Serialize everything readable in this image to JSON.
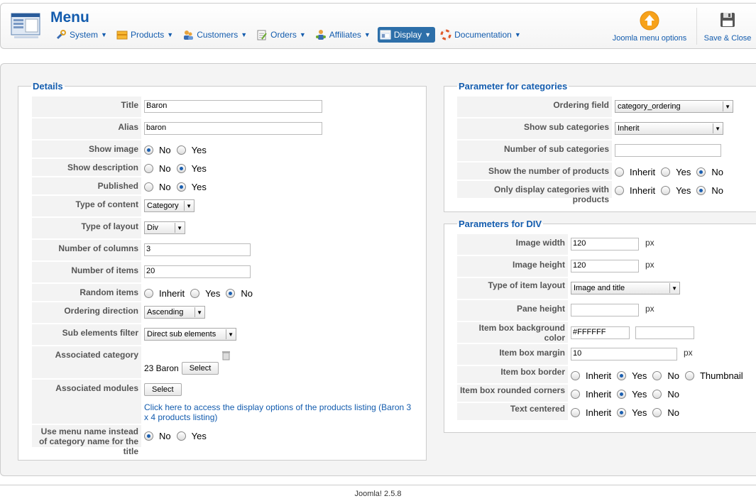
{
  "header": {
    "title": "Menu",
    "nav": [
      {
        "label": "System",
        "icon": "tools-icon"
      },
      {
        "label": "Products",
        "icon": "products-icon"
      },
      {
        "label": "Customers",
        "icon": "customers-icon"
      },
      {
        "label": "Orders",
        "icon": "orders-icon"
      },
      {
        "label": "Affiliates",
        "icon": "affiliates-icon"
      },
      {
        "label": "Display",
        "icon": "display-icon"
      },
      {
        "label": "Documentation",
        "icon": "lifebuoy-icon"
      }
    ],
    "menu_options_label": "Joomla menu options",
    "save_close_label": "Save & Close"
  },
  "details": {
    "legend": "Details",
    "title_label": "Title",
    "title_value": "Baron",
    "alias_label": "Alias",
    "alias_value": "baron",
    "show_image_label": "Show image",
    "show_description_label": "Show description",
    "published_label": "Published",
    "type_content_label": "Type of content",
    "type_content_value": "Category",
    "type_layout_label": "Type of layout",
    "type_layout_value": "Div",
    "num_columns_label": "Number of columns",
    "num_columns_value": "3",
    "num_items_label": "Number of items",
    "num_items_value": "20",
    "random_items_label": "Random items",
    "ordering_direction_label": "Ordering direction",
    "ordering_direction_value": "Ascending",
    "sub_filter_label": "Sub elements filter",
    "sub_filter_value": "Direct sub elements",
    "assoc_category_label": "Associated category",
    "assoc_category_value": "23 Baron",
    "assoc_modules_label": "Associated modules",
    "display_options_link": "Click here to access the display options of the products listing (Baron 3 x 4 products listing)",
    "use_menu_name_label": "Use menu name instead of category name for the title",
    "select_label": "Select"
  },
  "categories": {
    "legend": "Parameter for categories",
    "ordering_field_label": "Ordering field",
    "ordering_field_value": "category_ordering",
    "show_sub_label": "Show sub categories",
    "show_sub_value": "Inherit",
    "num_sub_label": "Number of sub categories",
    "num_sub_value": "",
    "show_num_products_label": "Show the number of products",
    "only_display_label": "Only display categories with products"
  },
  "div": {
    "legend": "Parameters for DIV",
    "image_width_label": "Image width",
    "image_width_value": "120",
    "image_height_label": "Image height",
    "image_height_value": "120",
    "item_layout_label": "Type of item layout",
    "item_layout_value": "Image and title",
    "pane_height_label": "Pane height",
    "pane_height_value": "",
    "bg_color_label": "Item box background color",
    "bg_color_value": "#FFFFFF",
    "margin_label": "Item box margin",
    "margin_value": "10",
    "border_label": "Item box border",
    "rounded_label": "Item box rounded corners",
    "centered_label": "Text centered",
    "px": "px"
  },
  "options": {
    "no": "No",
    "yes": "Yes",
    "inherit": "Inherit",
    "thumbnail": "Thumbnail"
  },
  "footer": {
    "version": "Joomla! 2.5.8"
  },
  "colors": {
    "accent": "#135cae",
    "active_nav": "#2d6fa9",
    "save_icon": "#555555",
    "menu_options_icon": "#f7a21b"
  }
}
